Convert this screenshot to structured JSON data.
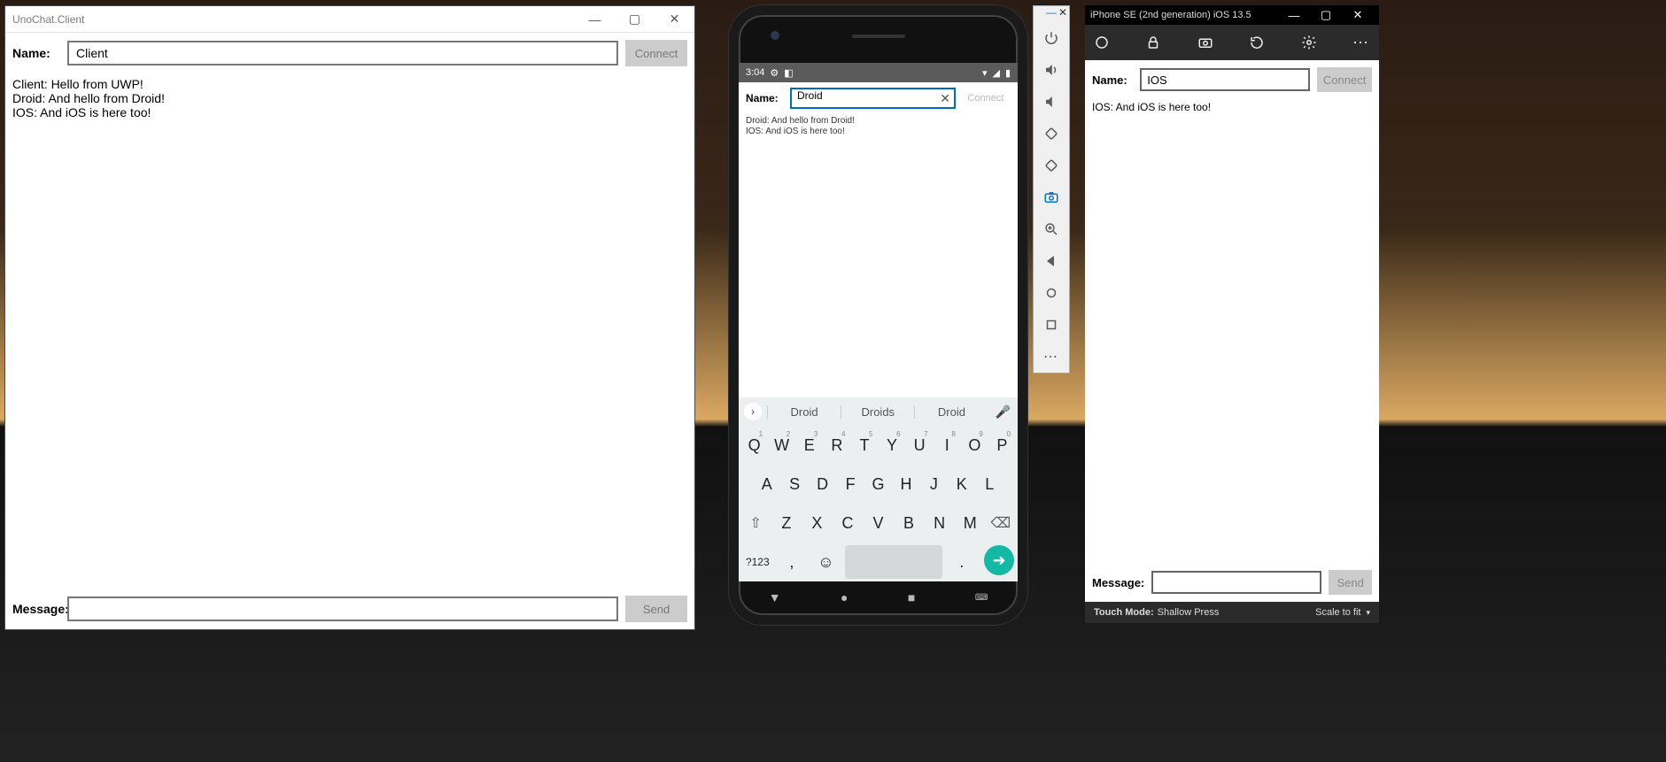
{
  "uwp": {
    "title": "UnoChat.Client",
    "name_label": "Name:",
    "name_value": "Client",
    "connect_label": "Connect",
    "messages": "Client: Hello from UWP!\nDroid: And hello from Droid!\nIOS: And iOS is here too!",
    "message_label": "Message:",
    "message_value": "",
    "send_label": "Send"
  },
  "android": {
    "status_time": "3:04",
    "name_label": "Name:",
    "name_value": "Droid",
    "connect_label": "Connect",
    "messages": "Droid: And hello from Droid!\nIOS: And iOS is here too!",
    "keyboard": {
      "suggestions": [
        "Droid",
        "Droids",
        "Droid"
      ],
      "row1": [
        "Q",
        "W",
        "E",
        "R",
        "T",
        "Y",
        "U",
        "I",
        "O",
        "P"
      ],
      "row1_nums": [
        "1",
        "2",
        "3",
        "4",
        "5",
        "6",
        "7",
        "8",
        "9",
        "0"
      ],
      "row2": [
        "A",
        "S",
        "D",
        "F",
        "G",
        "H",
        "J",
        "K",
        "L"
      ],
      "row3": [
        "Z",
        "X",
        "C",
        "V",
        "B",
        "N",
        "M"
      ],
      "sym_label": "?123"
    }
  },
  "emutools": {
    "items": [
      "power",
      "volume-up",
      "volume-down",
      "rotate-left",
      "rotate-right",
      "screenshot",
      "zoom",
      "back",
      "overview",
      "square",
      "more"
    ]
  },
  "ios": {
    "title": "iPhone SE (2nd generation) iOS 13.5",
    "name_label": "Name:",
    "name_value": "IOS",
    "connect_label": "Connect",
    "messages": "IOS: And iOS is here too!",
    "message_label": "Message:",
    "message_value": "",
    "send_label": "Send",
    "touch_mode_label": "Touch Mode:",
    "touch_mode_value": "Shallow Press",
    "scale_label": "Scale to fit"
  }
}
